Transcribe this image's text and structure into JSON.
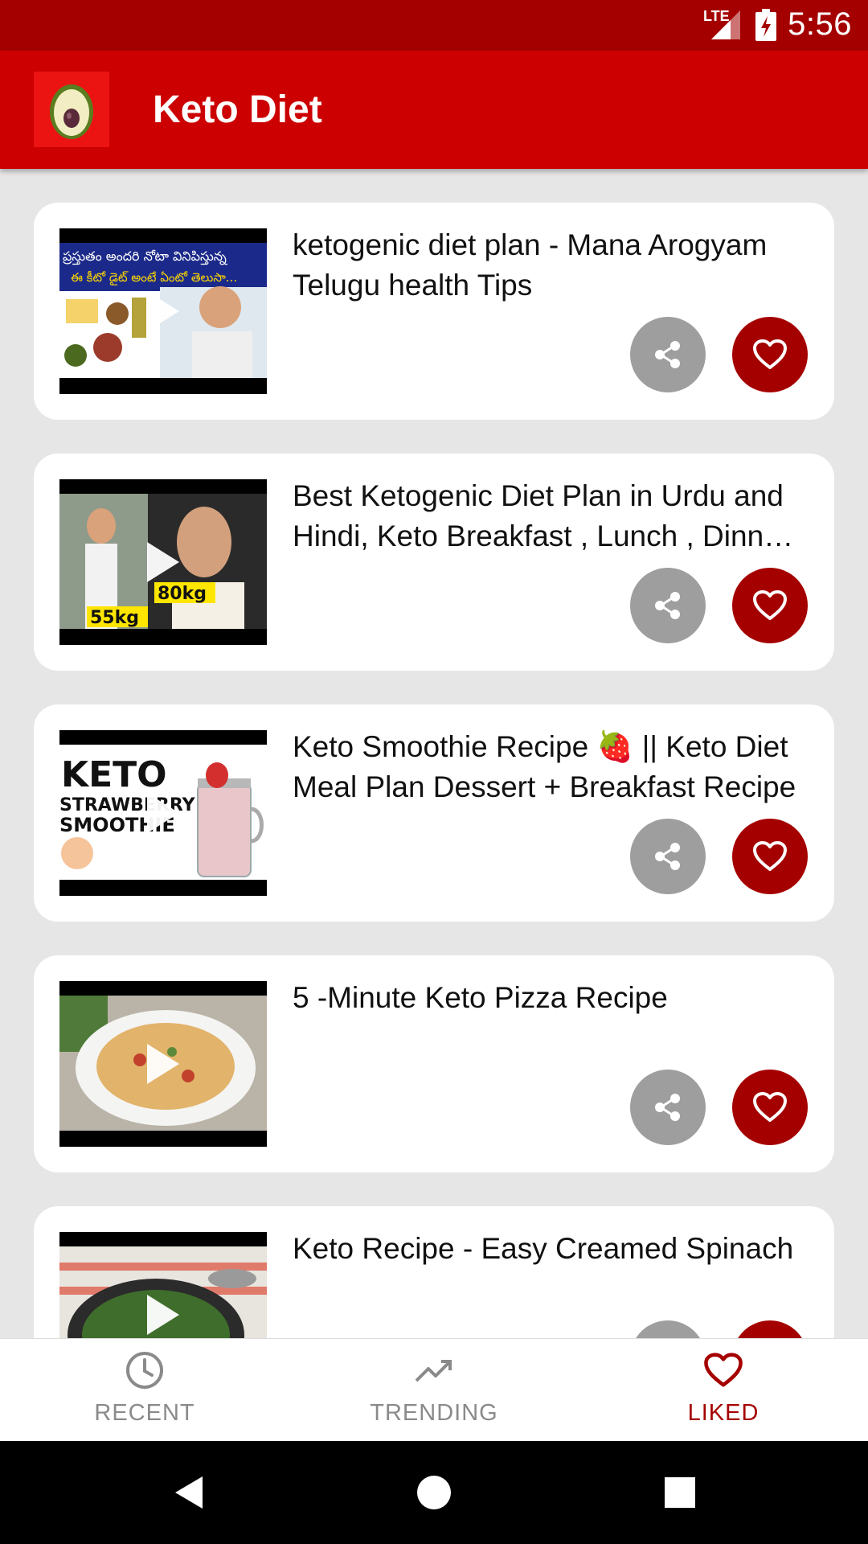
{
  "status_bar": {
    "time": "5:56",
    "network": "LTE"
  },
  "app_bar": {
    "title": "Keto Diet",
    "logo_icon": "avocado-logo"
  },
  "videos": [
    {
      "title": "ketogenic diet plan - Mana Arogyam Telugu health Tips",
      "thumbnail_caption_line1": "ప్రస్తుతం అందరి నోటా వినిపిస్తున్న",
      "thumbnail_caption_line2": "ఈ కీటో డైట్ అంటే ఏంటో తెలుసా..."
    },
    {
      "title": "Best Ketogenic Diet Plan in Urdu and Hindi, Keto Breakfast , Lunch , Dinner fo…",
      "thumbnail_label_a": "55kg",
      "thumbnail_label_b": "80kg"
    },
    {
      "title": "Keto Smoothie Recipe 🍓 || Keto Diet Meal Plan Dessert + Breakfast Recipe",
      "thumbnail_line1": "KETO",
      "thumbnail_line2": "STRAWBERRY",
      "thumbnail_line3": "SMOOTHIE"
    },
    {
      "title": "5 -Minute Keto Pizza Recipe"
    },
    {
      "title": "Keto Recipe - Easy Creamed Spinach"
    }
  ],
  "bottom_nav": [
    {
      "label": "RECENT",
      "icon": "clock-icon",
      "active": false
    },
    {
      "label": "TRENDING",
      "icon": "trending-up-icon",
      "active": false
    },
    {
      "label": "LIKED",
      "icon": "heart-icon",
      "active": true
    }
  ],
  "colors": {
    "primary": "#cc0000",
    "primary_dark": "#a50000",
    "share_button": "#9e9e9e",
    "background": "#e6e6e6"
  }
}
